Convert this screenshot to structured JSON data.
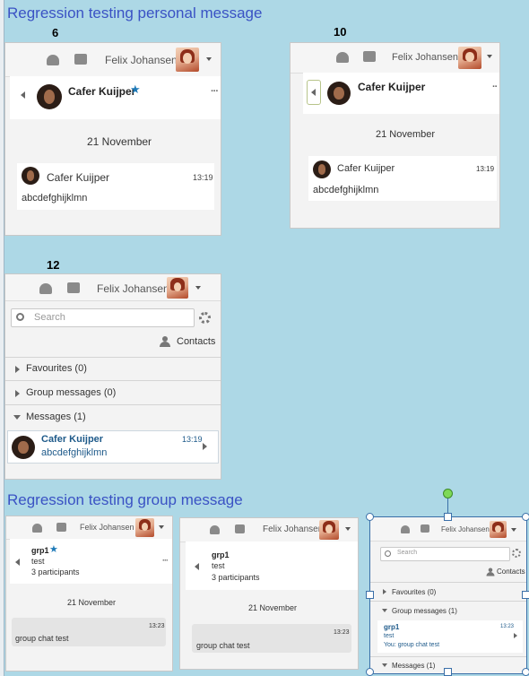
{
  "headings": {
    "personal": "Regression testing personal message",
    "group": "Regression testing group message"
  },
  "labels": {
    "six": "6",
    "ten": "10",
    "twelve": "12"
  },
  "user": {
    "name": "Felix Johansen"
  },
  "personal": {
    "contact": "Cafer Kuijper",
    "date": "21 November",
    "time": "13:19",
    "message": "abcdefghijklmn"
  },
  "contacts_view": {
    "search_placeholder": "Search",
    "contacts_label": "Contacts",
    "favourites": "Favourites (0)",
    "group_messages": "Group messages (0)",
    "messages": "Messages (1)",
    "item_name": "Cafer Kuijper",
    "item_time": "13:19",
    "item_message": "abcdefghijklmn"
  },
  "group": {
    "name": "grp1",
    "subtitle": "test",
    "participants": "3 participants",
    "date": "21 November",
    "time": "13:23",
    "message": "group chat test"
  },
  "group_contacts": {
    "search_placeholder": "Search",
    "contacts_label": "Contacts",
    "favourites": "Favourites (0)",
    "group_messages": "Group messages (1)",
    "item_name": "grp1",
    "item_time": "13:23",
    "item_sub": "test",
    "item_message": "You: group chat test",
    "messages": "Messages (1)"
  },
  "colors": {
    "background": "#add8e6",
    "heading": "#3a52c4",
    "accent": "#1e7ab8"
  }
}
